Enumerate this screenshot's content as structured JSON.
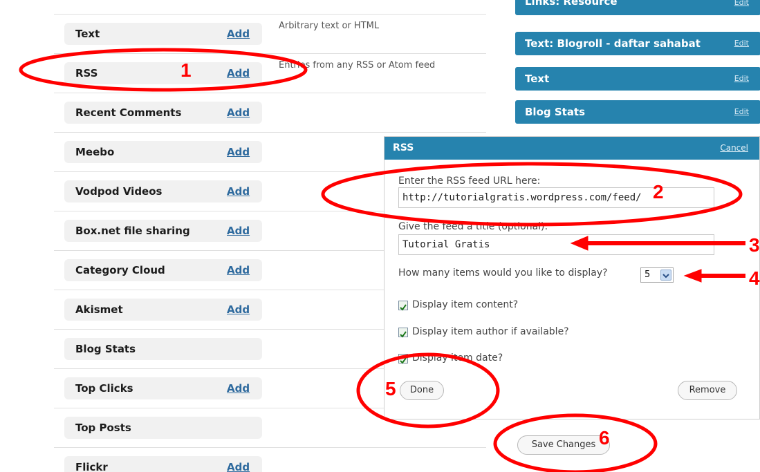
{
  "colors": {
    "widget_header": "#2683ae",
    "link": "#2e6a9e",
    "annotation": "#ff0000"
  },
  "available_widgets": [
    {
      "name": "Text",
      "add_label": "Add",
      "description": "Arbitrary text or HTML"
    },
    {
      "name": "RSS",
      "add_label": "Add",
      "description": "Entries from any RSS or Atom feed"
    },
    {
      "name": "Recent Comments",
      "add_label": "Add",
      "description": ""
    },
    {
      "name": "Meebo",
      "add_label": "Add",
      "description": ""
    },
    {
      "name": "Vodpod Videos",
      "add_label": "Add",
      "description": ""
    },
    {
      "name": "Box.net file sharing",
      "add_label": "Add",
      "description": ""
    },
    {
      "name": "Category Cloud",
      "add_label": "Add",
      "description": ""
    },
    {
      "name": "Akismet",
      "add_label": "Add",
      "description": ""
    },
    {
      "name": "Blog Stats",
      "add_label": "",
      "description": ""
    },
    {
      "name": "Top Clicks",
      "add_label": "Add",
      "description": ""
    },
    {
      "name": "Top Posts",
      "add_label": "",
      "description": ""
    },
    {
      "name": "Flickr",
      "add_label": "Add",
      "description": ""
    }
  ],
  "sidebar_widgets": [
    {
      "title": "Links: Resource",
      "edit_label": "Edit"
    },
    {
      "title": "Text: Blogroll - daftar sahabat",
      "edit_label": "Edit"
    },
    {
      "title": "Text",
      "edit_label": "Edit"
    },
    {
      "title": "Blog Stats",
      "edit_label": "Edit"
    }
  ],
  "rss_panel": {
    "title": "RSS",
    "cancel_label": "Cancel",
    "url_label": "Enter the RSS feed URL here:",
    "url_value": "http://tutorialgratis.wordpress.com/feed/",
    "title_label": "Give the feed a title (optional):",
    "title_value": "Tutorial Gratis",
    "items_label": "How many items would you like to display?",
    "items_value": "5",
    "checkboxes": [
      {
        "label": "Display item content?",
        "checked": true
      },
      {
        "label": "Display item author if available?",
        "checked": true
      },
      {
        "label": "Display item date?",
        "checked": true
      }
    ],
    "done_label": "Done",
    "remove_label": "Remove"
  },
  "save_changes_label": "Save Changes",
  "annotations": [
    "1",
    "2",
    "3",
    "4",
    "5",
    "6"
  ]
}
